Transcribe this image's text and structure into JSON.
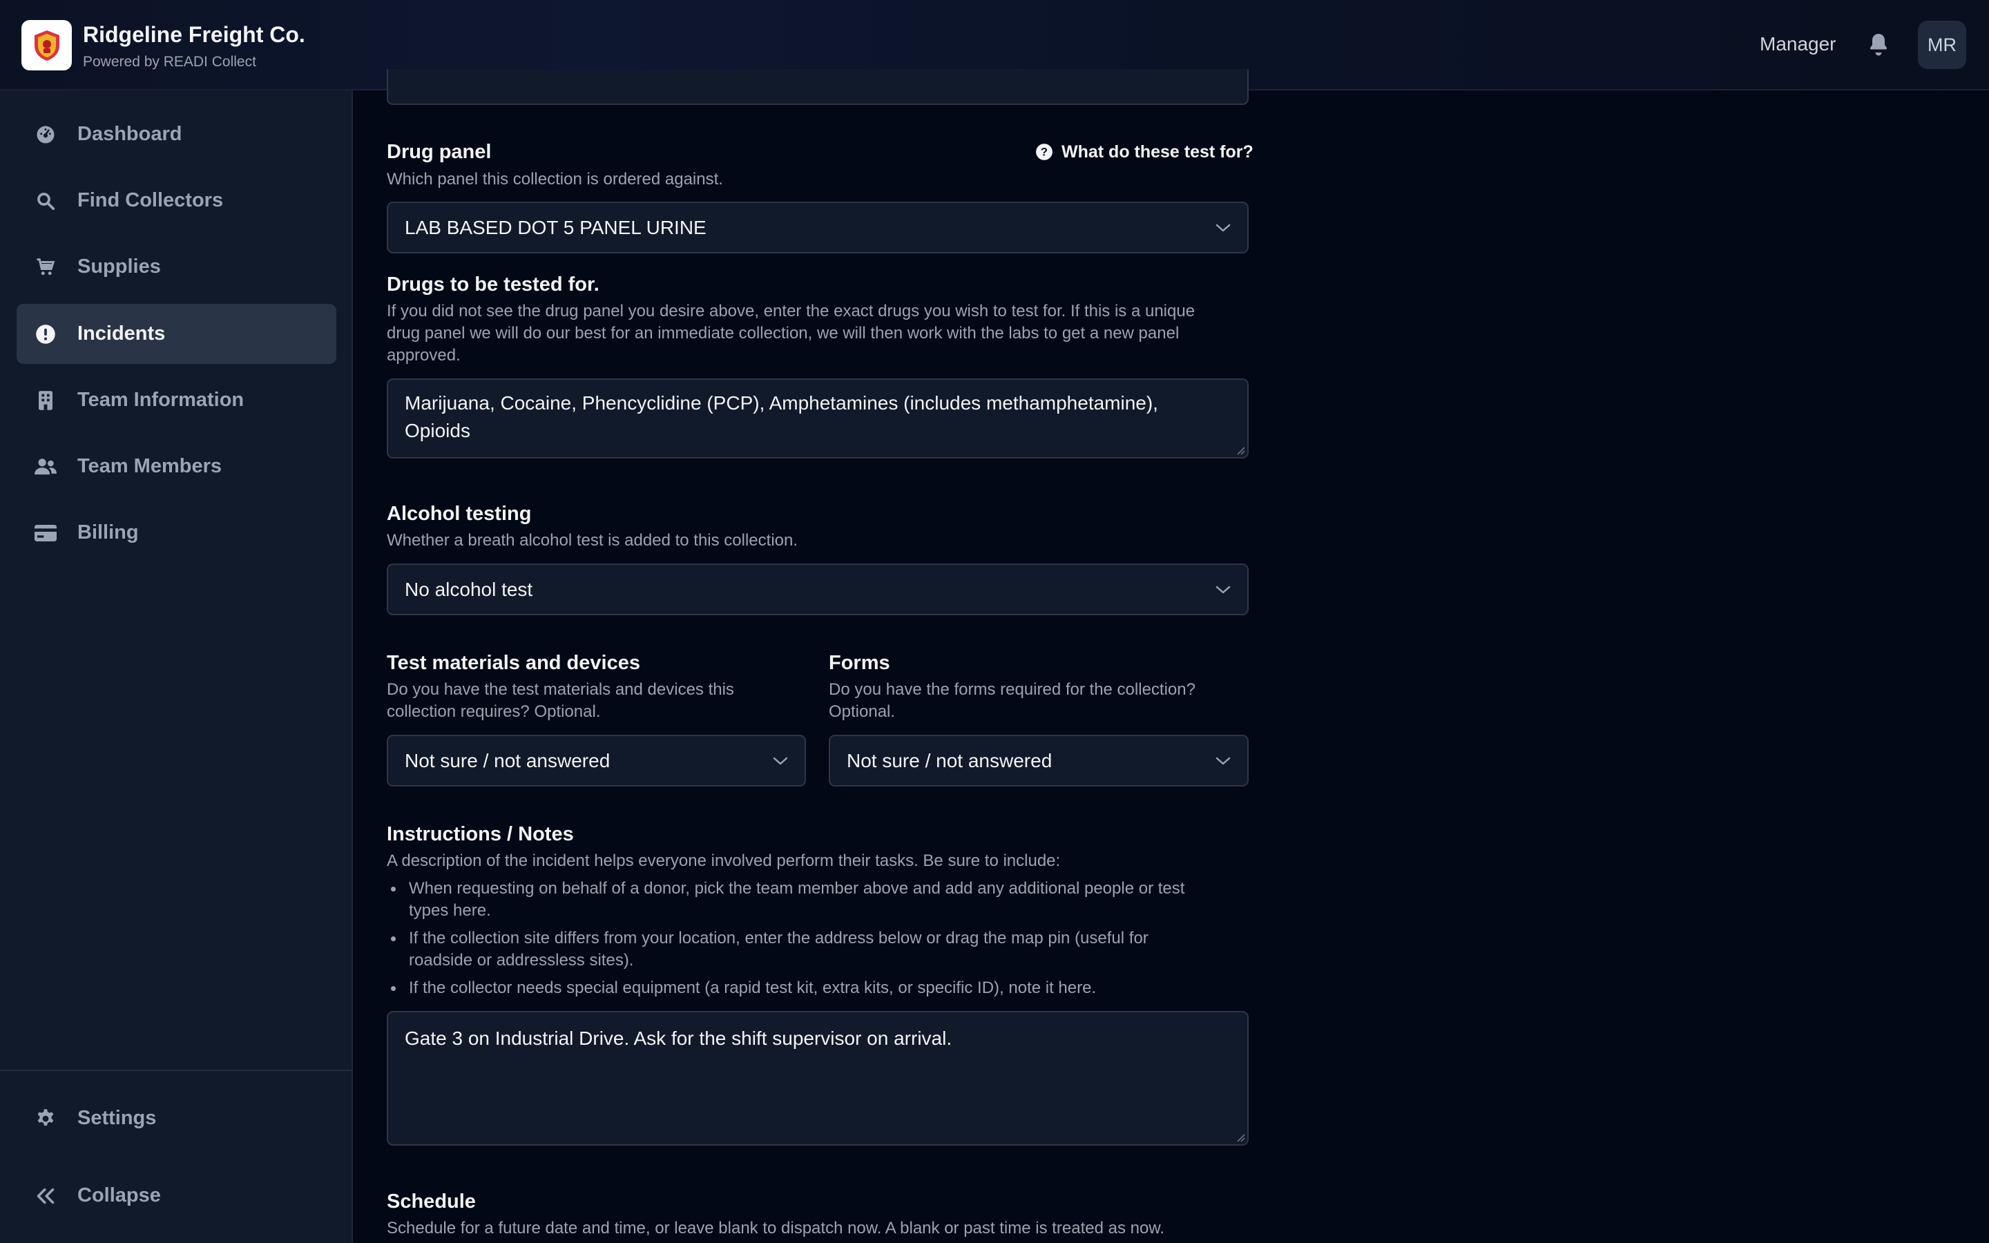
{
  "header": {
    "brand_name": "Ridgeline Freight Co.",
    "brand_sub": "Powered by READI Collect",
    "role": "Manager",
    "avatar_initials": "MR"
  },
  "sidebar": {
    "items": [
      {
        "label": "Dashboard",
        "icon": "dashboard-icon"
      },
      {
        "label": "Find Collectors",
        "icon": "search-icon"
      },
      {
        "label": "Supplies",
        "icon": "cart-icon"
      },
      {
        "label": "Incidents",
        "icon": "alert-icon",
        "active": true
      },
      {
        "label": "Team Information",
        "icon": "building-icon"
      },
      {
        "label": "Team Members",
        "icon": "users-icon"
      },
      {
        "label": "Billing",
        "icon": "credit-card-icon"
      }
    ],
    "footer": {
      "settings_label": "Settings",
      "collapse_label": "Collapse"
    }
  },
  "form": {
    "drug_panel": {
      "label": "Drug panel",
      "help": "Which panel this collection is ordered against.",
      "help_link": "What do these test for?",
      "value": "LAB BASED DOT 5 PANEL URINE"
    },
    "drugs_tested": {
      "label": "Drugs to be tested for.",
      "help_lines": [
        "If you did not see the drug panel you desire above, enter the exact drugs you wish to test for. If this is a unique",
        "drug panel we will do our best for an immediate collection, we will then work with the labs to get a new panel",
        "approved."
      ],
      "value": "Marijuana, Cocaine, Phencyclidine (PCP), Amphetamines (includes methamphetamine),\nOpioids"
    },
    "alcohol": {
      "label": "Alcohol testing",
      "help": "Whether a breath alcohol test is added to this collection.",
      "value": "No alcohol test"
    },
    "materials": {
      "label": "Test materials and devices",
      "help_lines": [
        "Do you have the test materials and devices this",
        "collection requires? Optional."
      ],
      "value": "Not sure / not answered"
    },
    "forms": {
      "label": "Forms",
      "help_lines": [
        "Do you have the forms required for the collection?",
        "Optional."
      ],
      "value": "Not sure / not answered"
    },
    "notes": {
      "label": "Instructions / Notes",
      "help": "A description of the incident helps everyone involved perform their tasks. Be sure to include:",
      "bullets": [
        [
          "When requesting on behalf of a donor, pick the team member above and add any additional people or test",
          "types here."
        ],
        [
          "If the collection site differs from your location, enter the address below or drag the map pin (useful for",
          "roadside or addressless sites)."
        ],
        [
          "If the collector needs special equipment (a rapid test kit, extra kits, or specific ID), note it here."
        ]
      ],
      "value": "Gate 3 on Industrial Drive. Ask for the shift supervisor on arrival."
    },
    "schedule": {
      "label": "Schedule",
      "help": "Schedule for a future date and time, or leave blank to dispatch now. A blank or past time is treated as now."
    }
  }
}
